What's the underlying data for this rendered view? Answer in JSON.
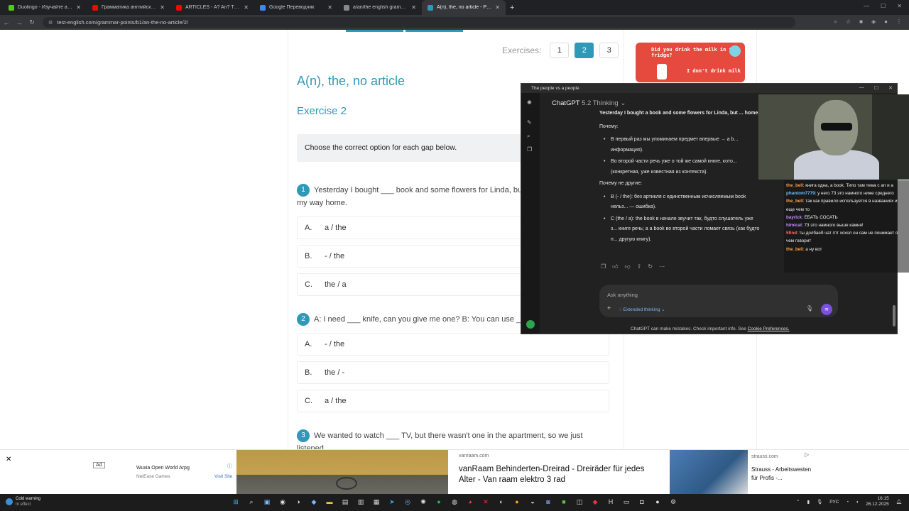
{
  "browser": {
    "tabs": [
      {
        "label": "Duolingo - Изучайте английск",
        "color": "#58cc02",
        "active": false
      },
      {
        "label": "Грамматика английского язы",
        "color": "#ff0000",
        "active": false
      },
      {
        "label": "ARTICLES - A? An? The? | How",
        "color": "#ff0000",
        "active": false
      },
      {
        "label": "Google Переводчик",
        "color": "#4285f4",
        "active": false
      },
      {
        "label": "a/an/the english grammar gam",
        "color": "#888888",
        "active": false
      },
      {
        "label": "A(n), the, no article - Page 2 of",
        "color": "#2e9ab8",
        "active": true
      }
    ],
    "url": "test-english.com/grammar-points/b1/an-the-no-article/2/"
  },
  "page": {
    "exercises_label": "Exercises:",
    "exercise_pages": [
      "1",
      "2",
      "3"
    ],
    "active_page": "2",
    "title": "A(n), the, no article",
    "exercise_heading": "Exercise 2",
    "instruction": "Choose the correct option for each gap below.",
    "questions": [
      {
        "num": "1",
        "text": "Yesterday I bought ___ book and some flowers for Linda, but",
        "text2": "my way home.",
        "options": [
          {
            "letter": "A.",
            "text": "a / the"
          },
          {
            "letter": "B.",
            "text": "- / the"
          },
          {
            "letter": "C.",
            "text": "the / a"
          }
        ]
      },
      {
        "num": "2",
        "text": "A: I need ___ knife, can you give me one? B: You can use ___",
        "options": [
          {
            "letter": "A.",
            "text": "- / the"
          },
          {
            "letter": "B.",
            "text": "the / -"
          },
          {
            "letter": "C.",
            "text": "a / the"
          }
        ]
      },
      {
        "num": "3",
        "text": "We wanted to watch ___ TV, but there wasn't one in the apartment, so we just listened"
      }
    ],
    "promo": {
      "line1": "Did you drink the milk in the fridge?",
      "line2": "I don't drink milk"
    }
  },
  "gpt": {
    "window_title": "The people vs a people",
    "model_name": "ChatGPT",
    "model_mode": "5.2 Thinking",
    "answer_intro": "Yesterday I bought a book and some flowers for Linda, but ... home.",
    "why_heading": "Почему:",
    "why_items": [
      "В первый раз мы упоминаем предмет впервые → a b... информация).",
      "Во второй части речь уже о той же самой книге, кото... (конкретная, уже известная из контекста)."
    ],
    "why_not_heading": "Почему не другие:",
    "why_not_items": [
      "B (- / the): без артикля с единственным исчисляемым book нельз... — ошибка).",
      "C (the / a): the book в начале звучит так, будто слушатель уже з... книге речь; а a book во второй части ломает связь (как будто п... другую книгу)."
    ],
    "input_placeholder": "Ask anything",
    "extended_label": "Extended thinking",
    "footer_text": "ChatGPT can make mistakes. Check important info. See",
    "footer_link": "Cookie Preferences."
  },
  "stream_chat": [
    {
      "user": "the_bell",
      "msg": "книга одна, a book. Типо там тема с an и a",
      "cls": "u1"
    },
    {
      "user": "phantom7779",
      "msg": "у него 73 это намного ниже среднего",
      "cls": "u2"
    },
    {
      "user": "the_bell",
      "msg": "так как правило используется в названиях и еще чем то",
      "cls": "u1"
    },
    {
      "user": "bayrick",
      "msg": "ЕБАТЬ СОСАТЬ",
      "cls": "u3"
    },
    {
      "user": "himicat",
      "msg": "73 это намного выше камня!",
      "cls": "u3"
    },
    {
      "user": "5find",
      "msg": "ты долбаеб чат гпт хохол он сам не понимает о чем говорит",
      "cls": "u4"
    },
    {
      "user": "the_bell",
      "msg": "а ну вот",
      "cls": "u1"
    }
  ],
  "ads": {
    "ad_label": "Ad",
    "ad1_title": "Wuxia Open World Arpg",
    "ad1_sub": "NetEase Games",
    "ad1_visit": "Visit Site",
    "ad2_source": "vanraam.com",
    "ad2_title": "vanRaam Behinderten-Dreirad - Dreiräder für jedes Alter - Van raam elektro 3 rad",
    "ad3_source": "strauss.com",
    "ad3_title": "Strauss - Arbeitswesten für Profis -..."
  },
  "taskbar": {
    "warn_title": "Cold warning",
    "warn_sub": "In effect",
    "lang": "РУС",
    "time": "16:15",
    "date": "26.12.2025"
  }
}
